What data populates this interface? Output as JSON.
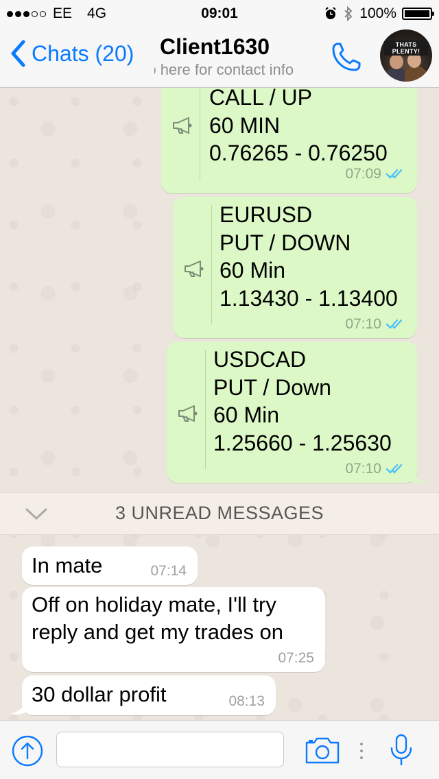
{
  "status_bar": {
    "carrier": "EE",
    "network": "4G",
    "time": "09:01",
    "battery": "100%",
    "battery_level": 1.0,
    "signal_bars_filled": 3,
    "signal_bars_total": 5
  },
  "nav": {
    "back_label": "Chats (20)",
    "contact_name": "Client1630",
    "contact_subtitle": "tap here for contact info",
    "avatar_text": "THATS PLENTY!"
  },
  "outgoing_messages": [
    {
      "lines": [
        "CALL / UP",
        "60 MIN",
        "0.76265 - 0.76250"
      ],
      "time": "07:09",
      "icon": "megaphone-icon",
      "ticks": "double-check-read"
    },
    {
      "lines": [
        "EURUSD",
        "PUT / DOWN",
        "60 Min",
        "1.13430 - 1.13400"
      ],
      "time": "07:10",
      "icon": "megaphone-icon",
      "ticks": "double-check-read"
    },
    {
      "lines": [
        "USDCAD",
        "PUT / Down",
        "60 Min",
        "1.25660 - 1.25630"
      ],
      "time": "07:10",
      "icon": "megaphone-icon",
      "ticks": "double-check-read"
    }
  ],
  "unread_banner": {
    "label": "3 UNREAD MESSAGES"
  },
  "incoming_messages": [
    {
      "lines": [
        "In mate"
      ],
      "time": "07:14"
    },
    {
      "lines": [
        "Off on holiday mate, I'll try",
        "reply and get my trades on"
      ],
      "time": "07:25"
    },
    {
      "lines": [
        "30 dollar profit"
      ],
      "time": "08:13"
    }
  ],
  "input_bar": {
    "message_placeholder": "",
    "icons": [
      "share-arrow-icon",
      "camera-icon",
      "microphone-icon"
    ]
  },
  "colors": {
    "accent": "#0a7aff",
    "outgoing_bubble": "#dcf8c6",
    "incoming_bubble": "#ffffff",
    "read_ticks": "#4fc3f7",
    "chat_background": "#ece5dd"
  }
}
